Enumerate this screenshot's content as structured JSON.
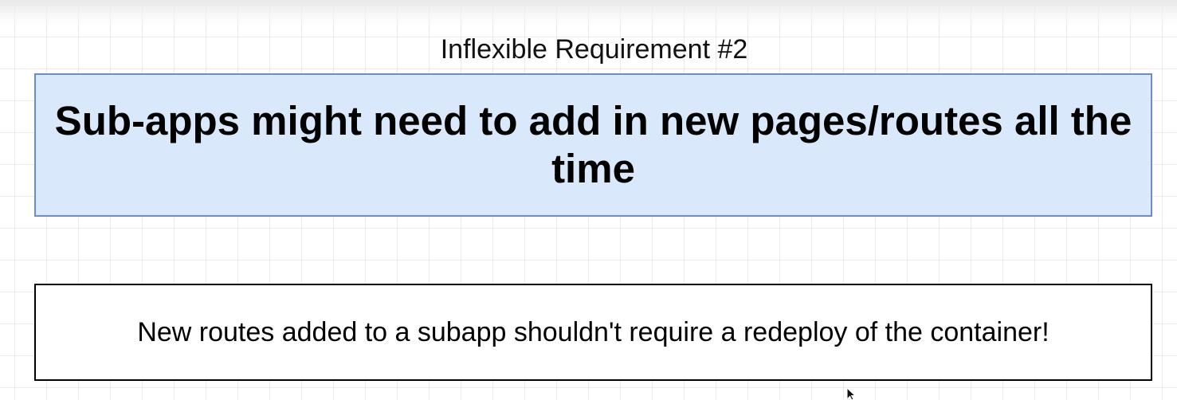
{
  "diagram": {
    "subtitle": "Inflexible Requirement #2",
    "main_statement": "Sub-apps might need to add in new pages/routes all the time",
    "note": "New routes added to a subapp shouldn't require a redeploy of the container!"
  },
  "colors": {
    "main_fill": "#dae8fc",
    "main_border": "#6c8ebf",
    "note_border": "#000000"
  },
  "icons": {
    "cursor": "mouse-pointer-icon"
  }
}
